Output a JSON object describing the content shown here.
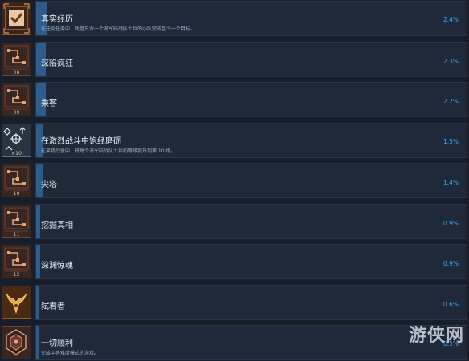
{
  "achievements": [
    {
      "title": "真实经历",
      "description": "在任何任务中，凭借只含一个海军陆战队士兵的小队完成至少一个目标。",
      "percent": "2.4%",
      "rarity": 0.024,
      "icon": "checkmark-frame-icon",
      "badge": "",
      "icon_style": "orange"
    },
    {
      "title": "深陷疯狂",
      "description": "",
      "percent": "2.3%",
      "rarity": 0.023,
      "icon": "map-nodes-icon",
      "badge": "08",
      "icon_style": "copper"
    },
    {
      "title": "乘客",
      "description": "",
      "percent": "2.2%",
      "rarity": 0.022,
      "icon": "map-nodes-icon",
      "badge": "09",
      "icon_style": "copper"
    },
    {
      "title": "在激烈战斗中饱经磨砺",
      "description": "在某场战役中，将每个海军陆战队士兵的等级提升到第 10 级。",
      "percent": "1.5%",
      "rarity": 0.015,
      "icon": "squad-rank-icon",
      "badge": "×10",
      "icon_style": "steel"
    },
    {
      "title": "尖塔",
      "description": "",
      "percent": "1.4%",
      "rarity": 0.014,
      "icon": "map-nodes-icon",
      "badge": "10",
      "icon_style": "copper"
    },
    {
      "title": "挖掘真相",
      "description": "",
      "percent": "0.9%",
      "rarity": 0.009,
      "icon": "map-nodes-icon",
      "badge": "11",
      "icon_style": "copper"
    },
    {
      "title": "深渊惊魂",
      "description": "",
      "percent": "0.9%",
      "rarity": 0.009,
      "icon": "map-nodes-icon",
      "badge": "12",
      "icon_style": "copper"
    },
    {
      "title": "弑君者",
      "description": "",
      "percent": "0.6%",
      "rarity": 0.006,
      "icon": "horned-crest-icon",
      "badge": "",
      "icon_style": "gold"
    },
    {
      "title": "一切顺利",
      "description": "完成中等难度模式的游戏。",
      "percent": "0.5%",
      "rarity": 0.005,
      "icon": "emblem-icon",
      "badge": "",
      "icon_style": "copper"
    }
  ],
  "watermark": "游侠网",
  "colors": {
    "background": "#181f2a",
    "card": "#20293a",
    "progress_bar": "#2d5b8a",
    "percent_text": "#3ea6ea",
    "copper_icon_bg": "#3a2620",
    "copper_icon_line": "#e8a57a"
  }
}
